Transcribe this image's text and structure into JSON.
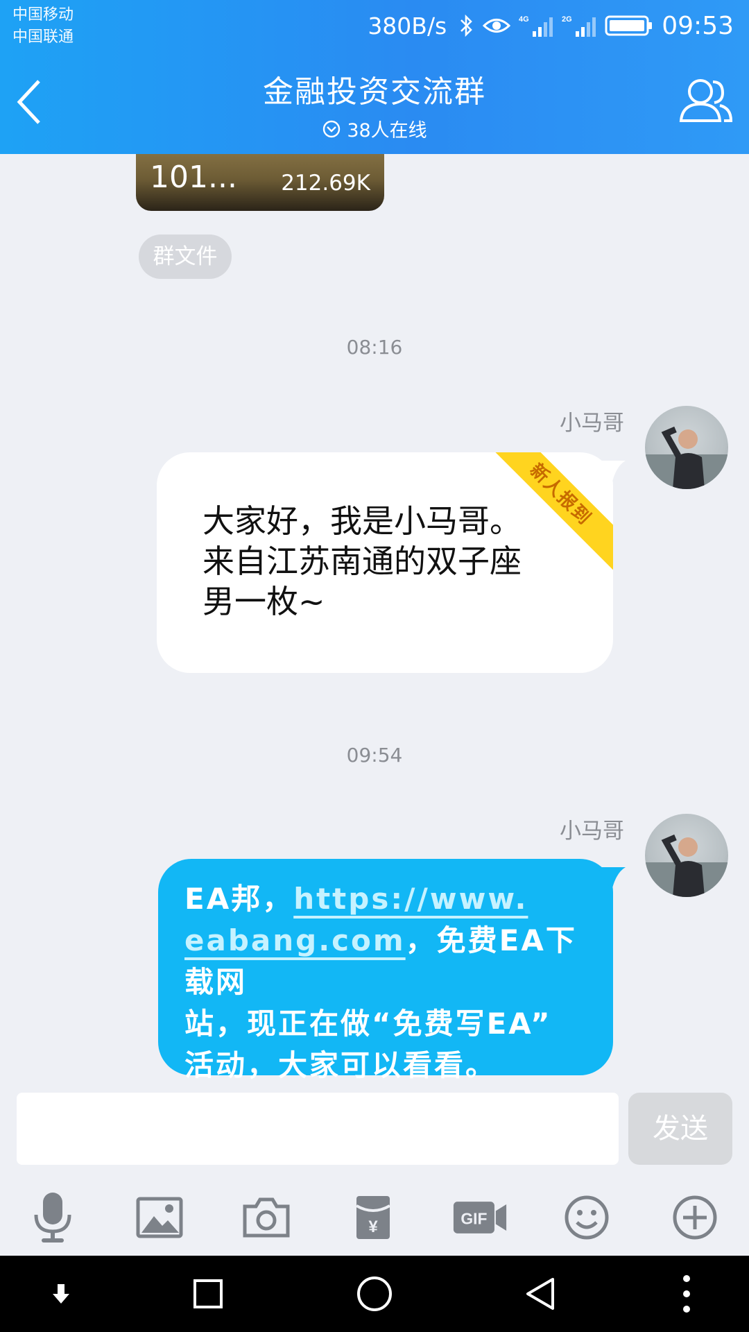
{
  "status_bar": {
    "carrier_1": "中国移动",
    "carrier_2": "中国联通",
    "net_speed": "380B/s",
    "time": "09:53",
    "icons": [
      "bluetooth-icon",
      "eye-icon",
      "signal-4g-icon",
      "signal-2g-icon",
      "battery-icon"
    ]
  },
  "header": {
    "title": "金融投资交流群",
    "online": "38人在线",
    "accent": "#2a8bf2"
  },
  "chat": {
    "file_card": {
      "name": "101...",
      "size": "212.69K"
    },
    "group_file_tag": "群文件",
    "messages": [
      {
        "timestamp": "08:16",
        "sender": "小马哥",
        "badge": "新人报到",
        "text_lines": [
          "大家好，我是小马哥。",
          "来自江苏南通的双子座",
          "男一枚~"
        ]
      },
      {
        "timestamp": "09:54",
        "sender": "小马哥",
        "line1_prefix": "EA邦，",
        "link_part1": "https://www.",
        "link_part2": "eabang.com",
        "line2_suffix": "，免费EA下载网",
        "line3": "站，现正在做“免费写EA”",
        "line4": "活动，大家可以看看。",
        "bubble_color": "#12b7f5"
      }
    ]
  },
  "input": {
    "value": "",
    "send_label": "发送"
  },
  "toolbar": [
    "microphone-icon",
    "image-icon",
    "camera-icon",
    "red-packet-icon",
    "gif-icon",
    "emoji-icon",
    "plus-icon"
  ],
  "navbar": [
    "download-icon",
    "recents-icon",
    "home-icon",
    "back-icon",
    "more-icon"
  ]
}
